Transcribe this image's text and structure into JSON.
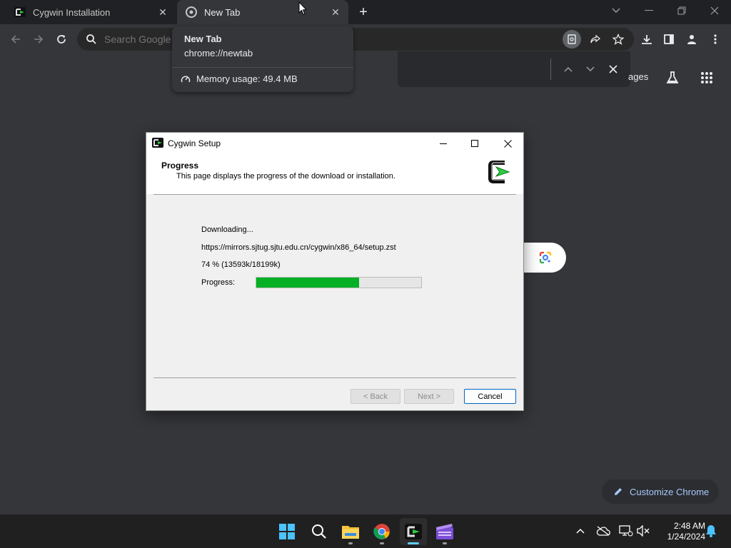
{
  "browser": {
    "tabs": [
      {
        "label": "Cygwin Installation",
        "active": false
      },
      {
        "label": "New Tab",
        "active": true
      }
    ],
    "omnibox_placeholder": "Search Google or type a URL"
  },
  "hovercard": {
    "title": "New Tab",
    "url": "chrome://newtab",
    "memory": "Memory usage: 49.4 MB"
  },
  "ntp": {
    "images_link": "ages",
    "customize_label": "Customize Chrome"
  },
  "dialog": {
    "title": "Cygwin Setup",
    "header_title": "Progress",
    "header_subtitle": "This page displays the progress of the download or installation.",
    "status": "Downloading...",
    "url": "https://mirrors.sjtug.sjtu.edu.cn/cygwin/x86_64/setup.zst",
    "percent_text": "74 %  (13593k/18199k)",
    "progress_label": "Progress:",
    "progress_fraction": 0.625,
    "buttons": {
      "back": "< Back",
      "next": "Next >",
      "cancel": "Cancel"
    }
  },
  "taskbar": {
    "time": "2:48 AM",
    "date": "1/24/2024"
  },
  "colors": {
    "progress_fill": "#06b025",
    "accent": "#0067c0",
    "chrome_bg": "#35363a"
  }
}
